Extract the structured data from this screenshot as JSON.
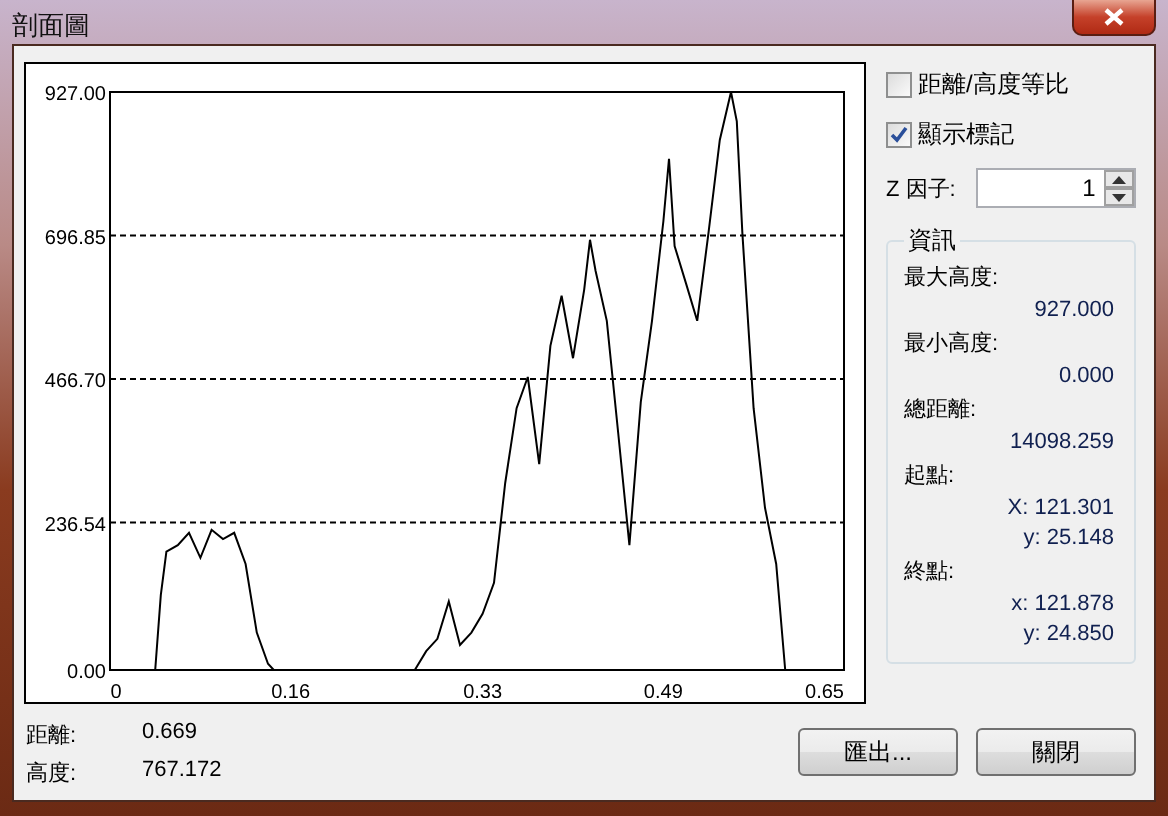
{
  "window": {
    "title": "剖面圖"
  },
  "chart": {
    "chart_data": {
      "type": "line",
      "grid": true,
      "xlim": [
        0,
        0.65
      ],
      "ylim": [
        0,
        927
      ],
      "xticks": [
        0,
        0.16,
        0.33,
        0.49,
        0.65
      ],
      "yticks": [
        {
          "value": 0,
          "label": "0.00"
        },
        {
          "value": 236.54,
          "label": "236.54"
        },
        {
          "value": 466.7,
          "label": "466.70"
        },
        {
          "value": 696.85,
          "label": "696.85"
        },
        {
          "value": 927,
          "label": "927.00"
        }
      ],
      "x": [
        0,
        0.04,
        0.045,
        0.05,
        0.06,
        0.07,
        0.08,
        0.09,
        0.1,
        0.11,
        0.12,
        0.13,
        0.14,
        0.145,
        0.2,
        0.27,
        0.28,
        0.29,
        0.3,
        0.31,
        0.32,
        0.33,
        0.34,
        0.35,
        0.36,
        0.37,
        0.38,
        0.39,
        0.4,
        0.41,
        0.42,
        0.425,
        0.43,
        0.44,
        0.45,
        0.46,
        0.47,
        0.48,
        0.49,
        0.495,
        0.5,
        0.51,
        0.52,
        0.53,
        0.54,
        0.55,
        0.555,
        0.56,
        0.57,
        0.58,
        0.59,
        0.598
      ],
      "series": [
        {
          "color": "#000000",
          "values": [
            0,
            0,
            120,
            190,
            200,
            220,
            180,
            225,
            210,
            220,
            170,
            60,
            10,
            0,
            0,
            0,
            30,
            50,
            110,
            40,
            60,
            90,
            140,
            300,
            420,
            470,
            330,
            520,
            600,
            500,
            610,
            690,
            640,
            560,
            380,
            200,
            430,
            560,
            720,
            820,
            680,
            620,
            560,
            700,
            850,
            927,
            880,
            700,
            420,
            260,
            170,
            0
          ]
        }
      ]
    }
  },
  "readouts": [
    {
      "label": "距離:",
      "value": "0.669"
    },
    {
      "label": "高度:",
      "value": "767.172"
    }
  ],
  "options": [
    {
      "label": "距離/高度等比",
      "checked": false
    },
    {
      "label": "顯示標記",
      "checked": true
    }
  ],
  "z_factor": {
    "label": "Z 因子:",
    "value": "1"
  },
  "info": {
    "title": "資訊",
    "items": [
      {
        "label": "最大高度:",
        "values": [
          "927.000"
        ]
      },
      {
        "label": "最小高度:",
        "values": [
          "0.000"
        ]
      },
      {
        "label": "總距離:",
        "values": [
          "14098.259"
        ]
      },
      {
        "label": "起點:",
        "values": [
          "X: 121.301",
          "y: 25.148"
        ]
      },
      {
        "label": "終點:",
        "values": [
          "x: 121.878",
          "y: 24.850"
        ]
      }
    ]
  },
  "buttons": [
    "匯出...",
    "關閉"
  ]
}
